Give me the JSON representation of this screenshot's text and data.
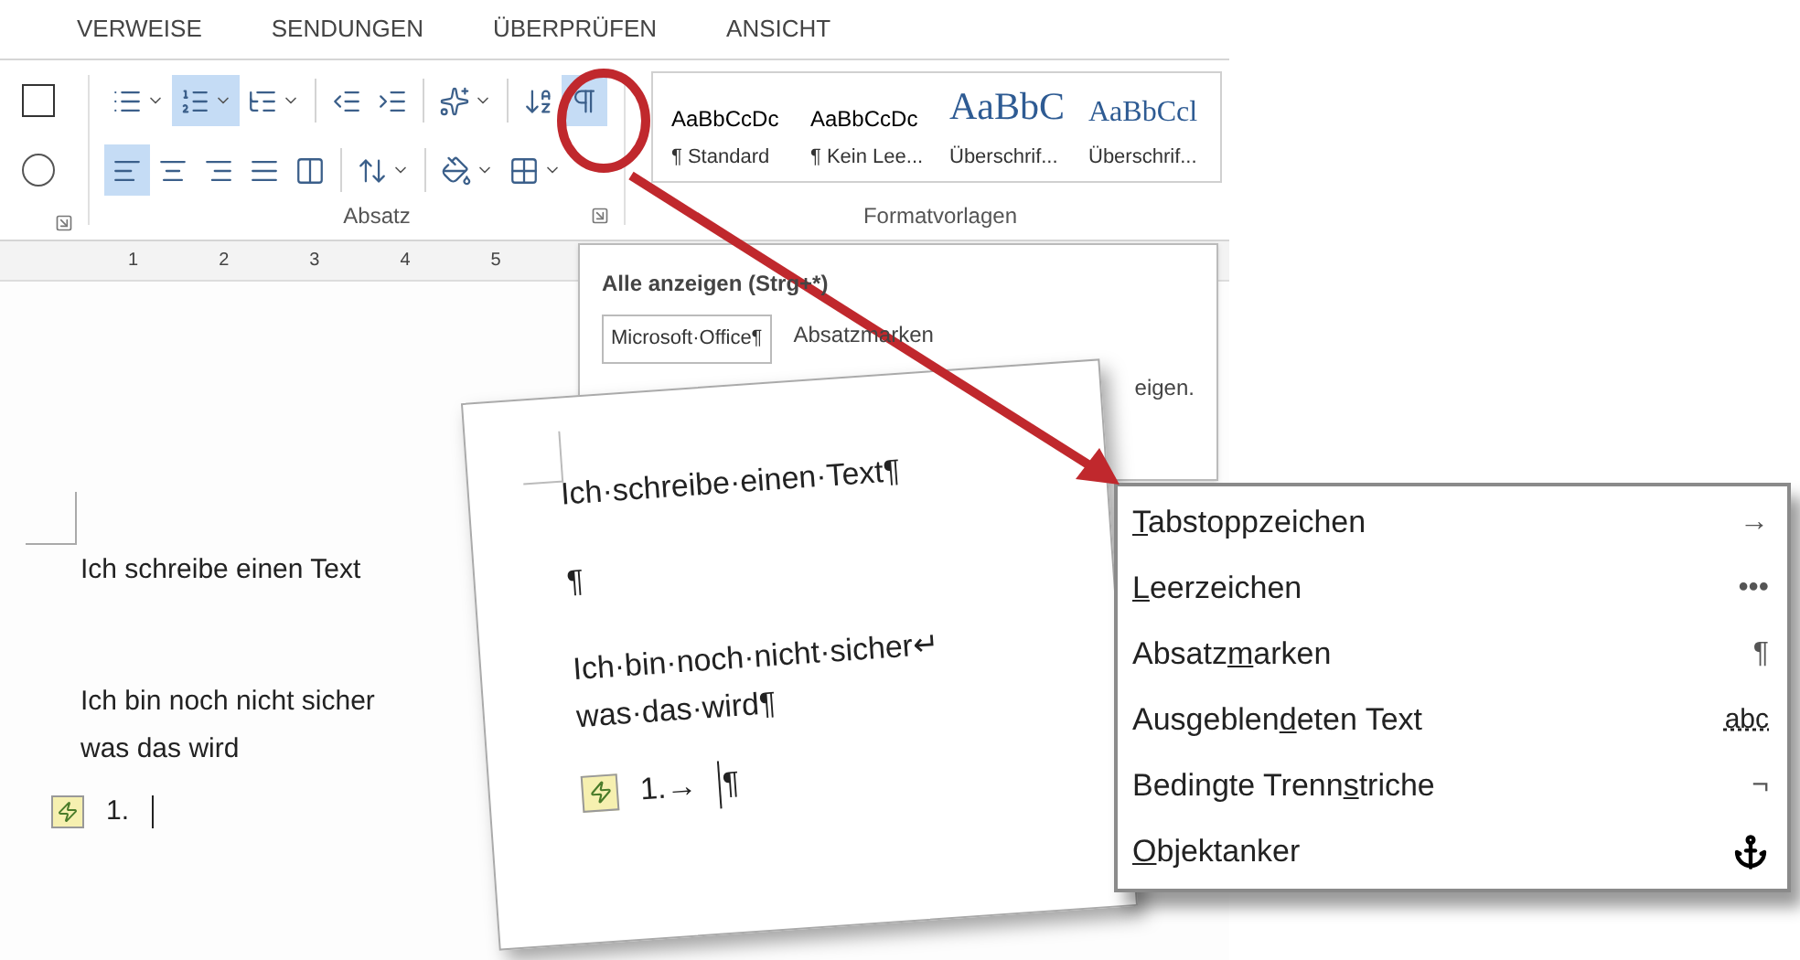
{
  "tabs": [
    {
      "label": "VERWEISE",
      "selected": false
    },
    {
      "label": "SENDUNGEN",
      "selected": false
    },
    {
      "label": "ÜBERPRÜFEN",
      "selected": false
    },
    {
      "label": "ANSICHT",
      "selected": false
    }
  ],
  "font_group": {
    "buttons": [
      {
        "kind": "letterbox",
        "selected": false
      },
      {
        "kind": "circled",
        "selected": false
      }
    ]
  },
  "paragraph_group": {
    "label": "Absatz",
    "row_1": [
      {
        "kind": "bullets",
        "dropdown": true,
        "selected": false
      },
      {
        "kind": "numbering",
        "dropdown": true,
        "selected": true
      },
      {
        "kind": "multilevel",
        "dropdown": true,
        "selected": false
      },
      {
        "kind": "separator"
      },
      {
        "kind": "outdent",
        "selected": false
      },
      {
        "kind": "indent",
        "selected": false
      },
      {
        "kind": "separator"
      },
      {
        "kind": "effects",
        "dropdown": true,
        "selected": false
      },
      {
        "kind": "separator"
      },
      {
        "kind": "sort",
        "selected": false
      },
      {
        "kind": "pilcrow",
        "selected": true
      }
    ],
    "row_2": [
      {
        "kind": "alignleft",
        "selected": true
      },
      {
        "kind": "center",
        "selected": false
      },
      {
        "kind": "alignright",
        "selected": false
      },
      {
        "kind": "justify",
        "selected": false
      },
      {
        "kind": "distributed",
        "selected": false
      },
      {
        "kind": "separator"
      },
      {
        "kind": "spacing",
        "dropdown": true,
        "selected": false
      },
      {
        "kind": "separator"
      },
      {
        "kind": "shading",
        "dropdown": true,
        "selected": false
      },
      {
        "kind": "borders",
        "dropdown": true,
        "selected": false
      }
    ]
  },
  "styles_group": {
    "label": "Formatvorlagen",
    "styles": [
      {
        "preview": "AaBbCcDc",
        "name": "¶ Standard",
        "kind": "body"
      },
      {
        "preview": "AaBbCcDc",
        "name": "¶ Kein Lee...",
        "kind": "body"
      },
      {
        "preview": "AaBbC",
        "name": "Überschrif...",
        "kind": "heading1"
      },
      {
        "preview": "AaBbCcl",
        "name": "Überschrif...",
        "kind": "heading2"
      }
    ]
  },
  "ruler": {
    "numbers": [
      "1",
      "2",
      "3",
      "4",
      "5"
    ]
  },
  "document": {
    "paragraphs": [
      {
        "lines": [
          "Ich schreibe einen Text"
        ]
      },
      {
        "lines": [
          "Ich bin noch nicht sicher",
          "was das wird"
        ]
      }
    ],
    "list_number": "1."
  },
  "tooltip": {
    "title": "Alle anzeigen (Strg+*)",
    "sample": "Microsoft·Office¶",
    "text": "Absatzmarken",
    "text_end": "eigen."
  },
  "zoomed_page": {
    "lines": [
      "Ich·schreibe·einen·Text¶",
      "¶",
      "Ich·bin·noch·nicht·sicher↵",
      "was·das·wird¶"
    ],
    "list_number": "1.→",
    "list_mark": "¶"
  },
  "marks_menu": {
    "items": [
      {
        "accel": "T",
        "after": "abstoppzeichen",
        "kind": "text",
        "mark": "→"
      },
      {
        "accel": "L",
        "after": "eerzeichen",
        "kind": "text",
        "mark": "•••"
      },
      {
        "before": "Absatz",
        "accel": "m",
        "after": "arken",
        "kind": "text",
        "mark": "¶"
      },
      {
        "before": "Ausgeblen",
        "accel": "d",
        "after": "eten Text",
        "kind": "dotted",
        "mark": "abc"
      },
      {
        "before": "Bedingte Trenn",
        "accel": "s",
        "after": "triche",
        "kind": "text",
        "mark": "¬"
      },
      {
        "accel": "O",
        "after": "bjektanker",
        "kind": "anchor"
      }
    ]
  }
}
